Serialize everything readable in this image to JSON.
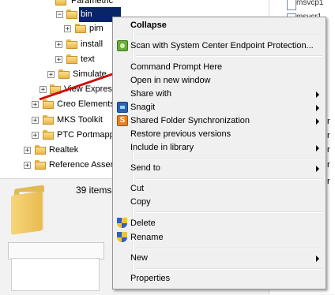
{
  "tree": {
    "items": [
      {
        "label": "Parametric",
        "expander": "",
        "selected": false
      },
      {
        "label": "bin",
        "expander": "−",
        "selected": true
      },
      {
        "label": "pim",
        "expander": "+",
        "selected": false
      },
      {
        "label": "install",
        "expander": "+",
        "selected": false
      },
      {
        "label": "text",
        "expander": "+",
        "selected": false
      },
      {
        "label": "Simulate",
        "expander": "+",
        "selected": false
      },
      {
        "label": "View Express",
        "expander": "+",
        "selected": false
      },
      {
        "label": "Creo Elements",
        "expander": "+",
        "selected": false
      },
      {
        "label": "MKS Toolkit",
        "expander": "+",
        "selected": false
      },
      {
        "label": "PTC Portmapper",
        "expander": "+",
        "selected": false
      },
      {
        "label": "Realtek",
        "expander": "+",
        "selected": false
      },
      {
        "label": "Reference Assem",
        "expander": "+",
        "selected": false
      }
    ]
  },
  "status": {
    "item_count": "39 items"
  },
  "right_pane": {
    "items": [
      "msvcp1",
      "msvcr1"
    ],
    "fragments": [
      "7",
      "r",
      "r",
      "r",
      "r",
      "r"
    ]
  },
  "context_menu": {
    "items": [
      {
        "label": "Collapse",
        "bold": true,
        "submenu": false,
        "icon": ""
      },
      {
        "label": "Scan with System Center Endpoint Protection...",
        "bold": false,
        "submenu": false,
        "icon": "scan-icon"
      },
      {
        "label": "Command Prompt Here",
        "bold": false,
        "submenu": false,
        "icon": ""
      },
      {
        "label": "Open in new window",
        "bold": false,
        "submenu": false,
        "icon": ""
      },
      {
        "label": "Share with",
        "bold": false,
        "submenu": true,
        "icon": ""
      },
      {
        "label": "Snagit",
        "bold": false,
        "submenu": true,
        "icon": "snagit-icon"
      },
      {
        "label": "Shared Folder Synchronization",
        "bold": false,
        "submenu": true,
        "icon": "sync-icon"
      },
      {
        "label": "Restore previous versions",
        "bold": false,
        "submenu": false,
        "icon": ""
      },
      {
        "label": "Include in library",
        "bold": false,
        "submenu": true,
        "icon": ""
      },
      {
        "label": "Send to",
        "bold": false,
        "submenu": true,
        "icon": ""
      },
      {
        "label": "Cut",
        "bold": false,
        "submenu": false,
        "icon": ""
      },
      {
        "label": "Copy",
        "bold": false,
        "submenu": false,
        "icon": ""
      },
      {
        "label": "Delete",
        "bold": false,
        "submenu": false,
        "icon": "shield-icon"
      },
      {
        "label": "Rename",
        "bold": false,
        "submenu": false,
        "icon": "shield-icon"
      },
      {
        "label": "New",
        "bold": false,
        "submenu": true,
        "icon": ""
      },
      {
        "label": "Properties",
        "bold": false,
        "submenu": false,
        "icon": ""
      }
    ]
  },
  "colors": {
    "selection": "#0a246a",
    "arrow": "#cc1010",
    "menu_background": "#f0f0f0"
  }
}
